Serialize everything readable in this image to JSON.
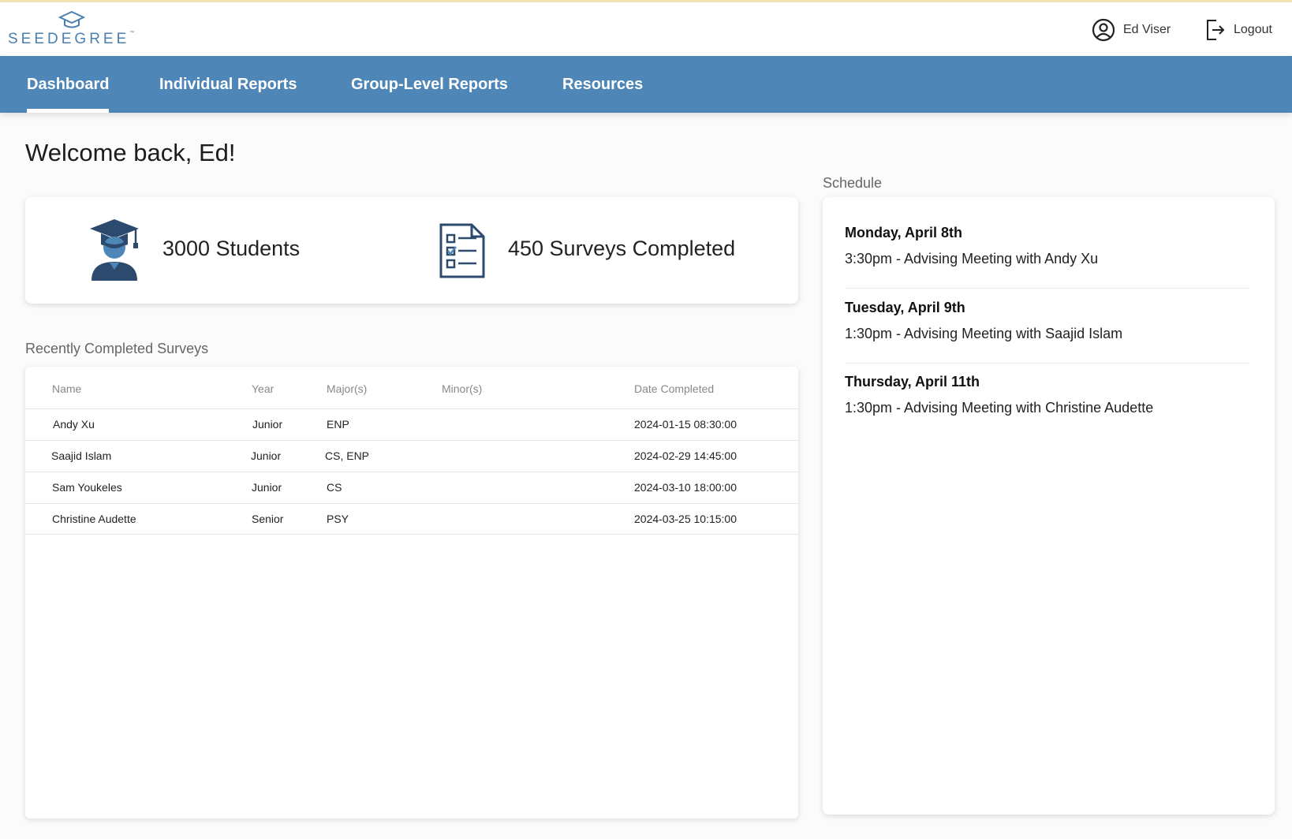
{
  "header": {
    "logo_text": "SEEDEGREE",
    "logo_tm": "™",
    "user_name": "Ed Viser",
    "logout_label": "Logout"
  },
  "nav": {
    "items": [
      {
        "label": "Dashboard",
        "active": true
      },
      {
        "label": "Individual Reports",
        "active": false
      },
      {
        "label": "Group-Level Reports",
        "active": false
      },
      {
        "label": "Resources",
        "active": false
      }
    ]
  },
  "main": {
    "welcome": "Welcome back, Ed!",
    "stats": {
      "students_label": "3000 Students",
      "surveys_label": "450 Surveys Completed"
    },
    "surveys_section_label": "Recently Completed Surveys",
    "table": {
      "columns": [
        "Name",
        "Year",
        "Major(s)",
        "Minor(s)",
        "Date Completed"
      ],
      "rows": [
        {
          "name": "Andy Xu",
          "year": "Junior",
          "majors": "ENP",
          "minors": "",
          "date": "2024-01-15 08:30:00"
        },
        {
          "name": "Saajid Islam",
          "year": "Junior",
          "majors": "CS, ENP",
          "minors": "",
          "date": "2024-02-29 14:45:00"
        },
        {
          "name": "Sam Youkeles",
          "year": "Junior",
          "majors": "CS",
          "minors": "",
          "date": "2024-03-10 18:00:00"
        },
        {
          "name": "Christine Audette",
          "year": "Senior",
          "majors": "PSY",
          "minors": "",
          "date": "2024-03-25 10:15:00"
        }
      ]
    }
  },
  "schedule": {
    "section_label": "Schedule",
    "items": [
      {
        "day": "Monday, April 8th",
        "event": "3:30pm - Advising Meeting with Andy Xu"
      },
      {
        "day": "Tuesday, April 9th",
        "event": "1:30pm - Advising Meeting with Saajid Islam"
      },
      {
        "day": "Thursday, April 11th",
        "event": "1:30pm - Advising Meeting with Christine Audette"
      }
    ]
  },
  "colors": {
    "brand_blue": "#4f86b8",
    "icon_navy": "#2c4a6e"
  },
  "icons": {
    "logo": "graduation-cap-icon",
    "user": "user-circle-icon",
    "logout": "logout-icon",
    "students": "graduate-student-icon",
    "surveys": "checklist-document-icon"
  }
}
